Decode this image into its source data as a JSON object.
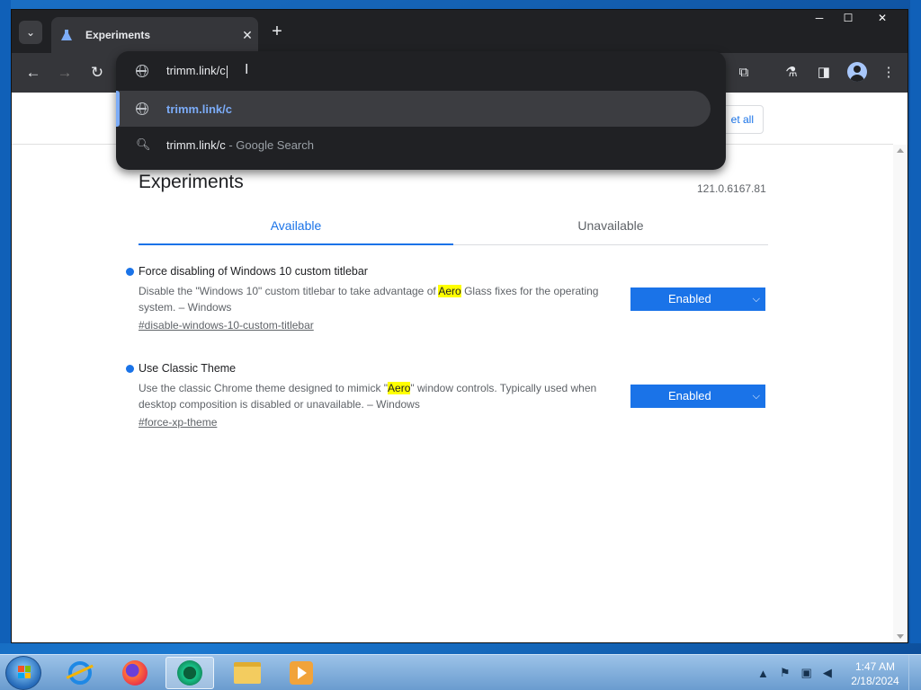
{
  "browser": {
    "tab_title": "Experiments",
    "tab_close": "✕",
    "new_tab": "+",
    "win_min": "─",
    "win_max": "☐",
    "win_close": "✕"
  },
  "omnibox": {
    "input_value": "trimm.link/c",
    "suggestion_url": "trimm.link/c",
    "suggestion_search": "trimm.link/c",
    "suggestion_search_suffix": " - Google Search"
  },
  "page": {
    "reset_label": "et all",
    "title": "Experiments",
    "version": "121.0.6167.81",
    "tabs": [
      {
        "label": "Available"
      },
      {
        "label": "Unavailable"
      }
    ],
    "experiments": [
      {
        "name": "Force disabling of Windows 10 custom titlebar",
        "desc_before": "Disable the \"Windows 10\" custom titlebar to take advantage of ",
        "highlight": "Aero",
        "desc_after": " Glass fixes for the operating system. – Windows",
        "link": "#disable-windows-10-custom-titlebar",
        "state": "Enabled"
      },
      {
        "name": "Use Classic Theme",
        "desc_before": "Use the classic Chrome theme designed to mimick \"",
        "highlight": "Aero",
        "desc_after": "\" window controls. Typically used when desktop composition is disabled or unavailable. – Windows",
        "link": "#force-xp-theme",
        "state": "Enabled"
      }
    ]
  },
  "taskbar": {
    "time": "1:47 AM",
    "date": "2/18/2024"
  },
  "colors": {
    "accent": "#1a73e8",
    "highlight": "#ffff00",
    "omnibox_selected_text": "#7cacf8"
  }
}
